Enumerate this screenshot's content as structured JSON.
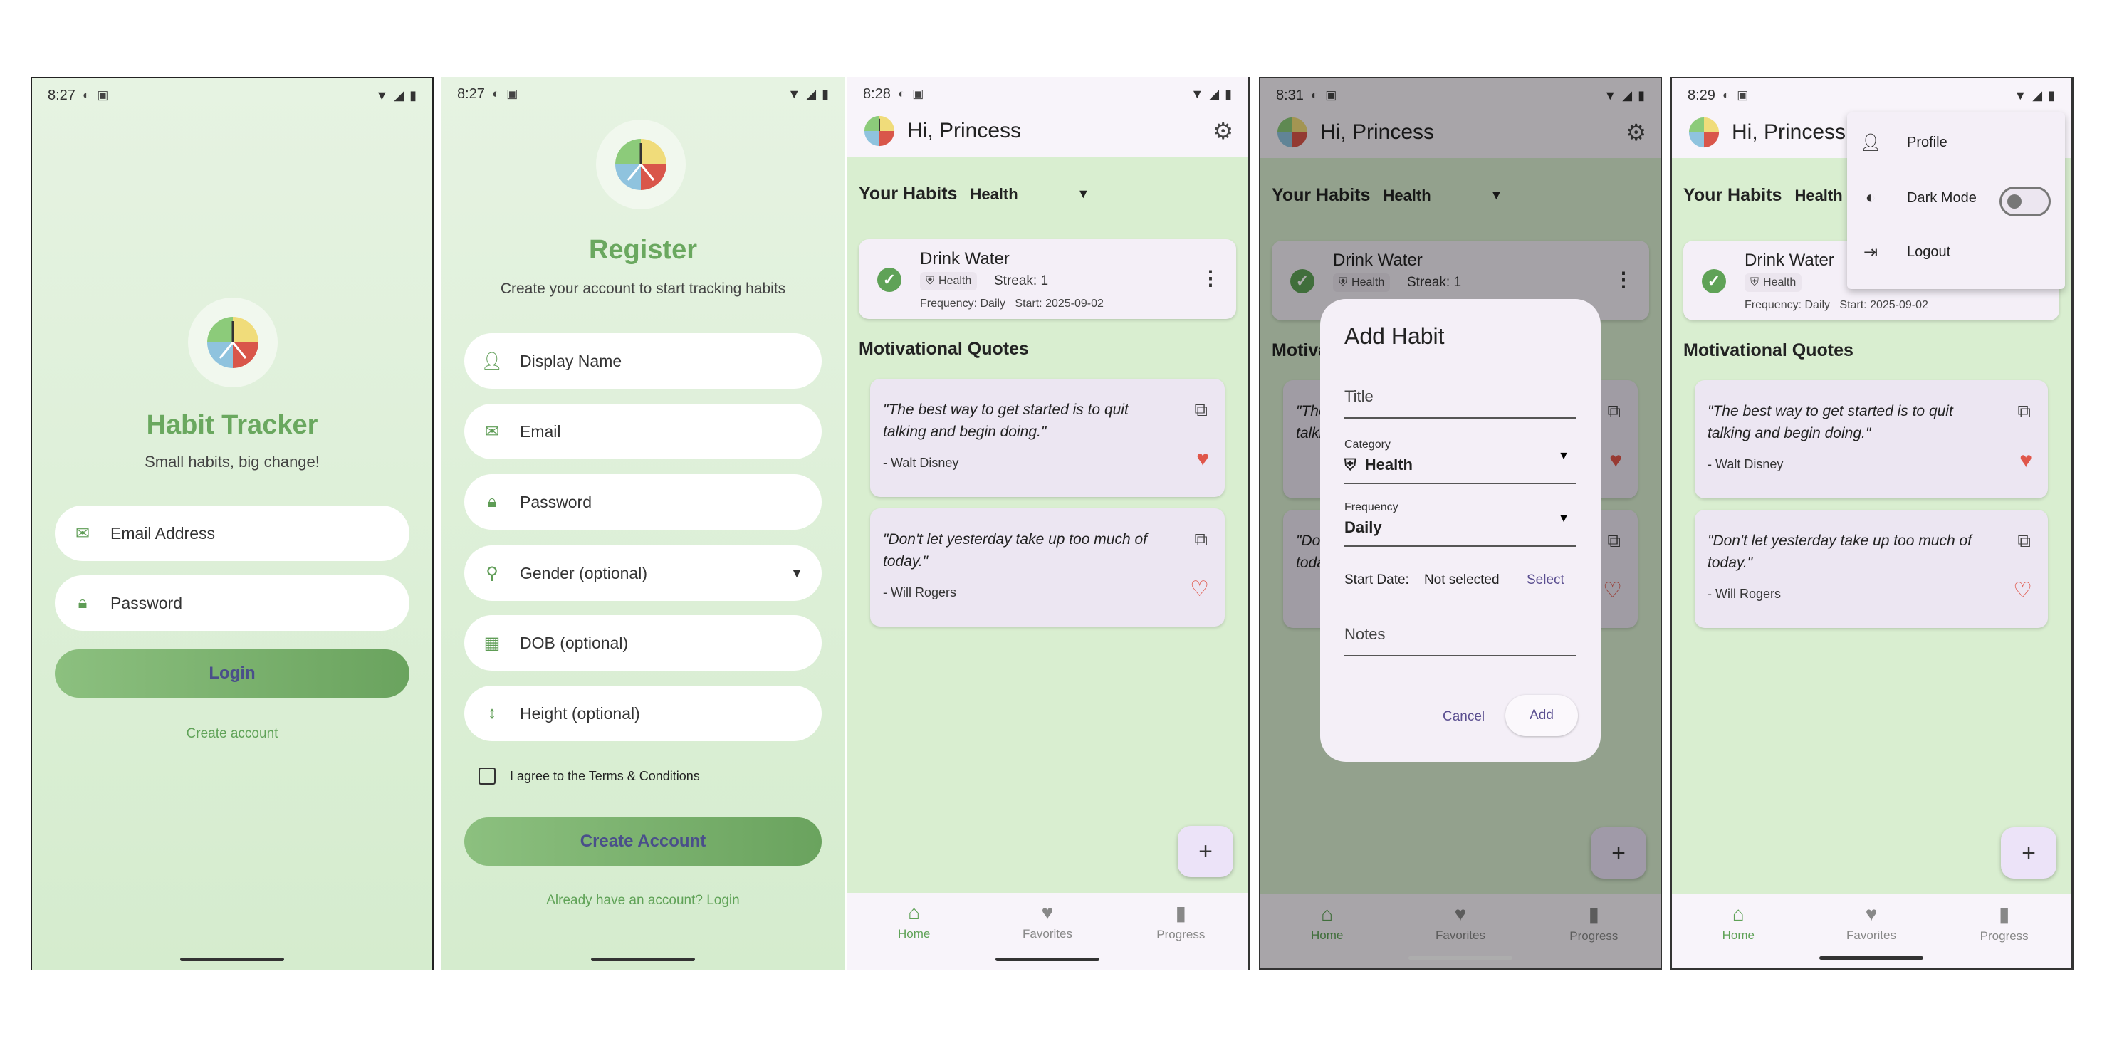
{
  "status": {
    "p1": {
      "time": "8:27"
    },
    "p2": {
      "time": "8:27"
    },
    "p3": {
      "time": "8:28"
    },
    "p4": {
      "time": "8:31"
    },
    "p5": {
      "time": "8:29"
    }
  },
  "login": {
    "app_title": "Habit Tracker",
    "tagline": "Small habits, big change!",
    "email_placeholder": "Email Address",
    "password_placeholder": "Password",
    "login_button": "Login",
    "create_account_link": "Create account"
  },
  "register": {
    "title": "Register",
    "subtitle": "Create your account to start tracking habits",
    "fields": [
      {
        "label": "Display Name",
        "icon": "person-icon"
      },
      {
        "label": "Email",
        "icon": "email-icon"
      },
      {
        "label": "Password",
        "icon": "lock-icon"
      },
      {
        "label": "Gender (optional)",
        "icon": "person-outline-icon"
      },
      {
        "label": "DOB (optional)",
        "icon": "calendar-icon"
      },
      {
        "label": "Height (optional)",
        "icon": "height-icon"
      }
    ],
    "terms_label": "I agree to the Terms & Conditions",
    "create_button": "Create Account",
    "login_link": "Already have an account? Login"
  },
  "home": {
    "greeting": "Hi, Princess",
    "your_habits_label": "Your Habits",
    "category_filter": "Health",
    "habit": {
      "name": "Drink Water",
      "category": "Health",
      "streak": "Streak: 1",
      "frequency": "Frequency: Daily",
      "start": "Start: 2025-09-02"
    },
    "quotes_title": "Motivational Quotes",
    "quotes": [
      {
        "text": "\"The best way to get started is to quit talking and begin doing.\"",
        "author": "- Walt Disney",
        "favorited": true
      },
      {
        "text": "\"Don't let yesterday take up too much of today.\"",
        "author": "- Will Rogers",
        "favorited": false
      }
    ],
    "fab_label": "+",
    "nav": [
      {
        "label": "Home",
        "icon": "home-icon",
        "active": true
      },
      {
        "label": "Favorites",
        "icon": "heart-icon",
        "active": false
      },
      {
        "label": "Progress",
        "icon": "bar-chart-icon",
        "active": false
      }
    ]
  },
  "add_habit_dialog": {
    "title": "Add Habit",
    "title_placeholder": "Title",
    "category_label": "Category",
    "category_value": "Health",
    "frequency_label": "Frequency",
    "frequency_value": "Daily",
    "start_date_label": "Start Date:",
    "start_date_value": "Not selected",
    "select_button": "Select",
    "notes_placeholder": "Notes",
    "cancel_button": "Cancel",
    "add_button": "Add"
  },
  "profile_menu": {
    "items": [
      {
        "label": "Profile",
        "icon": "person-icon"
      },
      {
        "label": "Dark Mode",
        "icon": "brightness-icon"
      },
      {
        "label": "Logout",
        "icon": "logout-icon"
      }
    ],
    "dark_mode_on": false
  },
  "colors": {
    "accent_green": "#5fa257",
    "button_text": "#4a4f8a",
    "heart_red": "#e0564a"
  }
}
